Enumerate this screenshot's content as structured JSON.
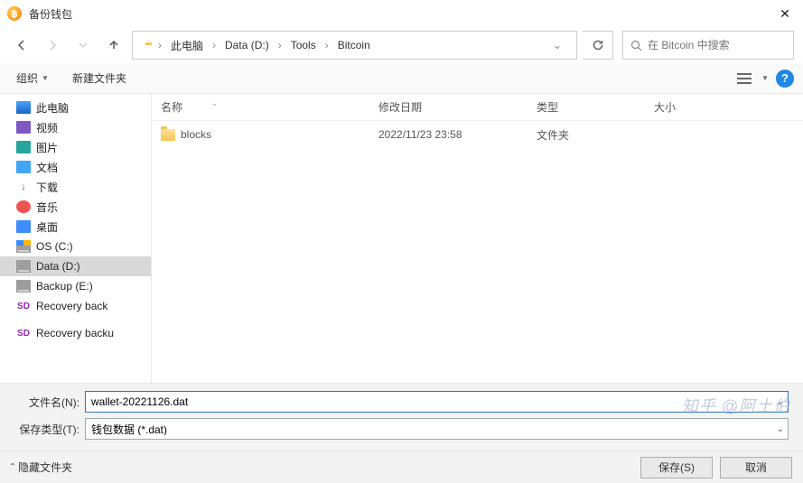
{
  "window": {
    "title": "备份钱包"
  },
  "breadcrumb": {
    "root": "此电脑",
    "drive": "Data (D:)",
    "folder1": "Tools",
    "folder2": "Bitcoin"
  },
  "search": {
    "placeholder": "在 Bitcoin 中搜索"
  },
  "toolbar": {
    "organize": "组织",
    "newfolder": "新建文件夹"
  },
  "columns": {
    "name": "名称",
    "date": "修改日期",
    "type": "类型",
    "size": "大小"
  },
  "sidebar": {
    "items": [
      {
        "label": "此电脑"
      },
      {
        "label": "视频"
      },
      {
        "label": "图片"
      },
      {
        "label": "文档"
      },
      {
        "label": "下载"
      },
      {
        "label": "音乐"
      },
      {
        "label": "桌面"
      },
      {
        "label": "OS (C:)"
      },
      {
        "label": "Data (D:)"
      },
      {
        "label": "Backup (E:)"
      },
      {
        "label": "Recovery back"
      },
      {
        "label": "Recovery backu"
      }
    ]
  },
  "files": [
    {
      "name": "blocks",
      "date": "2022/11/23 23:58",
      "type": "文件夹",
      "size": ""
    }
  ],
  "form": {
    "filename_label": "文件名(N):",
    "filename_value": "wallet-20221126.dat",
    "filetype_label": "保存类型(T):",
    "filetype_value": "钱包数据 (*.dat)"
  },
  "footer": {
    "hide": "隐藏文件夹",
    "save": "保存(S)",
    "cancel": "取消"
  },
  "watermark": "知乎 @阿土伯"
}
